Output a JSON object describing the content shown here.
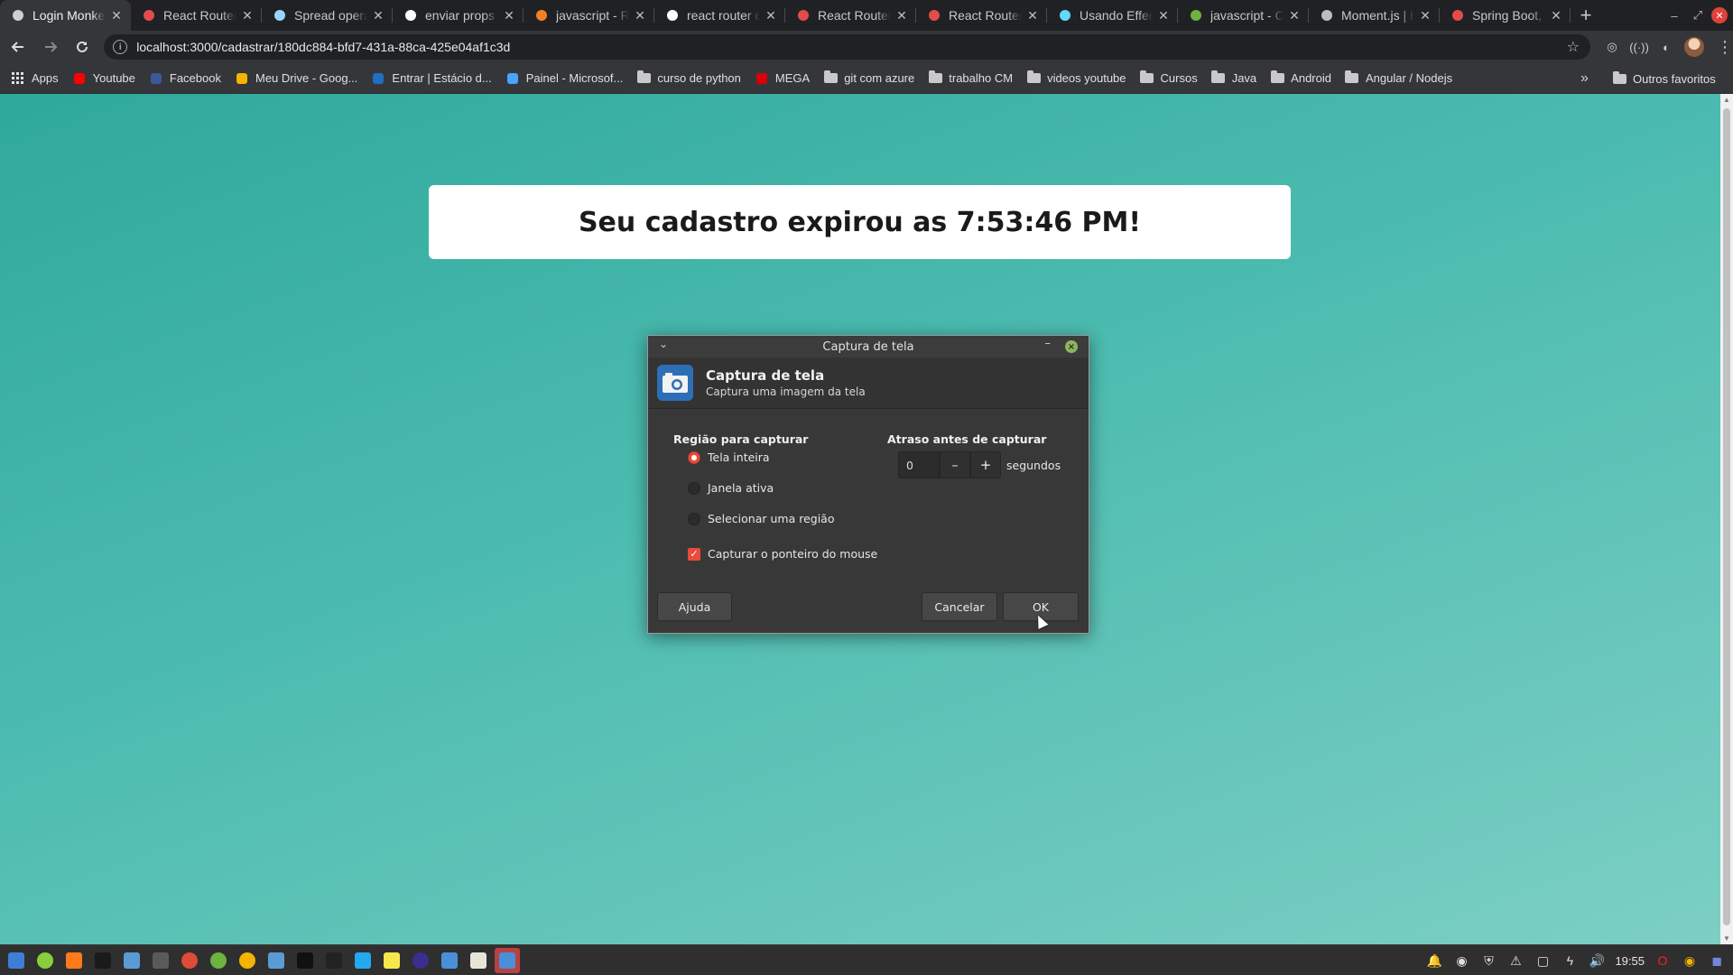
{
  "browser": {
    "tabs": [
      {
        "title": "Login Monkey",
        "icon": "chrome-icon",
        "color": "#cfcfcf",
        "active": true
      },
      {
        "title": "React Router",
        "icon": "react-router-icon",
        "color": "#e24c4b"
      },
      {
        "title": "Spread opera",
        "icon": "mdn-icon",
        "color": "#9ad5ff"
      },
      {
        "title": "enviar props",
        "icon": "google-icon",
        "color": "#ffffff"
      },
      {
        "title": "javascript - Re",
        "icon": "stackoverflow-icon",
        "color": "#f48024"
      },
      {
        "title": "react router d",
        "icon": "google-icon",
        "color": "#ffffff"
      },
      {
        "title": "React Router",
        "icon": "react-router-icon",
        "color": "#e24c4b"
      },
      {
        "title": "React Router",
        "icon": "react-router-icon",
        "color": "#e24c4b"
      },
      {
        "title": "Usando Effec",
        "icon": "react-icon",
        "color": "#61dafb"
      },
      {
        "title": "javascript - Co",
        "icon": "stackexchange-icon",
        "color": "#6cb33f"
      },
      {
        "title": "Moment.js | H",
        "icon": "moment-icon",
        "color": "#bdbdbd"
      },
      {
        "title": "Spring Boot, I",
        "icon": "spring-icon",
        "color": "#e24c4b"
      }
    ],
    "url": "localhost:3000/cadastrar/180dc884-bfd7-431a-88ca-425e04af1c3d",
    "bookmarks": [
      {
        "label": "Apps",
        "icon": "apps-grid-icon",
        "color": "#e0e0e0"
      },
      {
        "label": "Youtube",
        "icon": "youtube-icon",
        "color": "#ff0000"
      },
      {
        "label": "Facebook",
        "icon": "facebook-icon",
        "color": "#3b5998"
      },
      {
        "label": "Meu Drive - Goog...",
        "icon": "google-drive-icon",
        "color": "#f4b400"
      },
      {
        "label": "Entrar | Estácio d...",
        "icon": "estacio-icon",
        "color": "#1e6fbf"
      },
      {
        "label": "Painel - Microsof...",
        "icon": "azure-icon",
        "color": "#4aa3ff"
      },
      {
        "label": "curso de python",
        "icon": "folder-icon"
      },
      {
        "label": "MEGA",
        "icon": "mega-icon",
        "color": "#d90007"
      },
      {
        "label": "git com azure",
        "icon": "folder-icon"
      },
      {
        "label": "trabalho CM",
        "icon": "folder-icon"
      },
      {
        "label": "videos youtube",
        "icon": "folder-icon"
      },
      {
        "label": "Cursos",
        "icon": "folder-icon"
      },
      {
        "label": "Java",
        "icon": "folder-icon"
      },
      {
        "label": "Android",
        "icon": "folder-icon"
      },
      {
        "label": "Angular / Nodejs",
        "icon": "folder-icon"
      }
    ],
    "other_bookmarks": "Outros favoritos"
  },
  "page": {
    "message": "Seu cadastro expirou as 7:53:46 PM!"
  },
  "dialog": {
    "window_title": "Captura de tela",
    "header_title": "Captura de tela",
    "header_subtitle": "Captura uma imagem da tela",
    "region_title": "Região para capturar",
    "region_options": [
      {
        "label": "Tela inteira",
        "selected": true
      },
      {
        "label": "Janela ativa",
        "selected": false
      },
      {
        "label": "Selecionar uma região",
        "selected": false
      }
    ],
    "pointer_checkbox": {
      "label": "Capturar o ponteiro do mouse",
      "checked": true
    },
    "delay_title": "Atraso antes de capturar",
    "delay_value": "0",
    "delay_unit": "segundos",
    "help_button": "Ajuda",
    "cancel_button": "Cancelar",
    "ok_button": "OK"
  },
  "taskbar": {
    "clock": "19:55",
    "apps": [
      {
        "name": "show-desktop-icon",
        "color": "#3d7fd6"
      },
      {
        "name": "mint-menu-icon",
        "color": "#87cf3e"
      },
      {
        "name": "firefox-icon",
        "color": "#ff7a1a"
      },
      {
        "name": "terminal-icon",
        "color": "#1a1a1a"
      },
      {
        "name": "files-icon",
        "color": "#5b9bd5"
      },
      {
        "name": "calculator-icon",
        "color": "#5a5a5a"
      },
      {
        "name": "chrome-icon",
        "color": "#dd4b39"
      },
      {
        "name": "leaf-icon",
        "color": "#6cb33f"
      },
      {
        "name": "chrome-icon",
        "color": "#f4b400"
      },
      {
        "name": "folder-icon",
        "color": "#5b9bd5"
      },
      {
        "name": "terminal-icon",
        "color": "#111111"
      },
      {
        "name": "terminal-icon",
        "color": "#222222"
      },
      {
        "name": "vscode-icon",
        "color": "#23a9f2"
      },
      {
        "name": "sticky-notes-icon",
        "color": "#f6e84c"
      },
      {
        "name": "eclipse-icon",
        "color": "#3b2e8f"
      },
      {
        "name": "file-manager-icon",
        "color": "#4a90d9"
      },
      {
        "name": "text-editor-icon",
        "color": "#e8e4d8"
      },
      {
        "name": "screenshot-icon",
        "color": "#4a90d9"
      }
    ]
  }
}
